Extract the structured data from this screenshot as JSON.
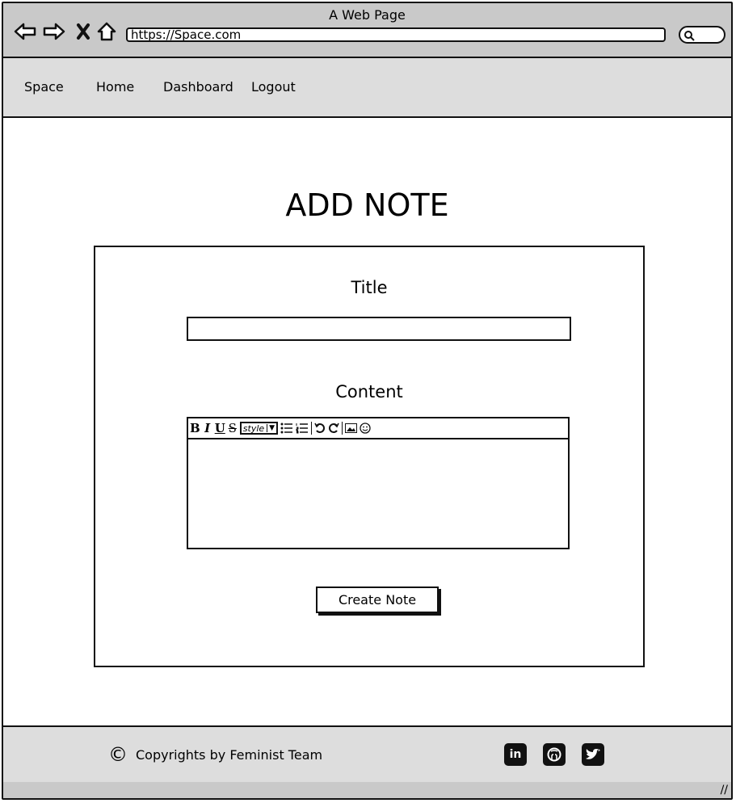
{
  "browser": {
    "window_title": "A Web Page",
    "url": "https://Space.com"
  },
  "nav": {
    "brand": "Space",
    "items": [
      {
        "label": "Home"
      },
      {
        "label": "Dashboard"
      },
      {
        "label": "Logout"
      }
    ]
  },
  "main": {
    "heading": "ADD NOTE",
    "title_label": "Title",
    "title_value": "",
    "content_label": "Content",
    "content_value": "",
    "editor_style_label": "style",
    "create_button": "Create Note"
  },
  "footer": {
    "copyright": "Copyrights by Feminist Team",
    "social": [
      {
        "icon": "linkedin-icon"
      },
      {
        "icon": "github-icon"
      },
      {
        "icon": "twitter-icon"
      }
    ]
  }
}
